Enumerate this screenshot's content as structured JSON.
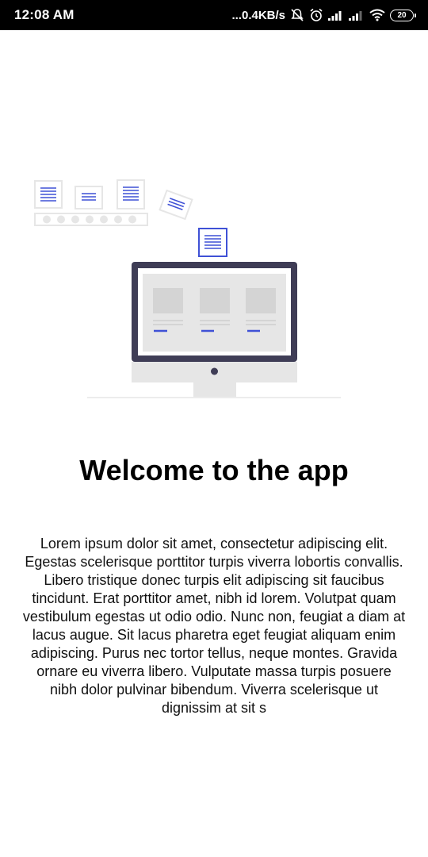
{
  "status_bar": {
    "time": "12:08 AM",
    "network_speed": "...0.4KB/s",
    "battery_level": "20",
    "icons": [
      "alarm-off-icon",
      "alarm-icon",
      "signal-icon",
      "signal-icon",
      "wifi-icon",
      "battery-icon"
    ]
  },
  "welcome": {
    "title": "Welcome to the app",
    "body": "Lorem ipsum dolor sit amet, consectetur adipiscing elit. Egestas scelerisque porttitor turpis viverra lobortis convallis. Libero tristique donec turpis elit adipiscing sit faucibus tincidunt. Erat porttitor amet, nibh id lorem. Volutpat quam vestibulum egestas ut odio odio. Nunc non, feugiat a diam at lacus augue. Sit lacus pharetra eget feugiat aliquam enim adipiscing. Purus nec tortor tellus, neque montes. Gravida ornare eu viverra libero. Vulputate massa turpis posuere nibh dolor pulvinar bibendum. Viverra scelerisque ut dignissim at sit s"
  },
  "colors": {
    "accent": "#3f51d6",
    "monitor_frame": "#3f3d56",
    "light_gray": "#e6e6e6"
  }
}
